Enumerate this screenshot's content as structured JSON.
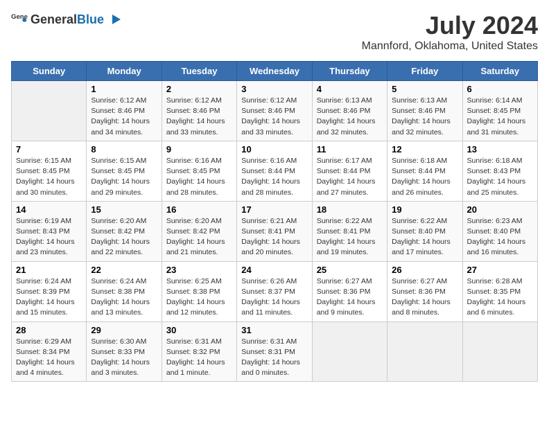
{
  "logo": {
    "general": "General",
    "blue": "Blue"
  },
  "title": "July 2024",
  "subtitle": "Mannford, Oklahoma, United States",
  "days_header": [
    "Sunday",
    "Monday",
    "Tuesday",
    "Wednesday",
    "Thursday",
    "Friday",
    "Saturday"
  ],
  "weeks": [
    [
      {
        "day": "",
        "sunrise": "",
        "sunset": "",
        "daylight": ""
      },
      {
        "day": "1",
        "sunrise": "Sunrise: 6:12 AM",
        "sunset": "Sunset: 8:46 PM",
        "daylight": "Daylight: 14 hours and 34 minutes."
      },
      {
        "day": "2",
        "sunrise": "Sunrise: 6:12 AM",
        "sunset": "Sunset: 8:46 PM",
        "daylight": "Daylight: 14 hours and 33 minutes."
      },
      {
        "day": "3",
        "sunrise": "Sunrise: 6:12 AM",
        "sunset": "Sunset: 8:46 PM",
        "daylight": "Daylight: 14 hours and 33 minutes."
      },
      {
        "day": "4",
        "sunrise": "Sunrise: 6:13 AM",
        "sunset": "Sunset: 8:46 PM",
        "daylight": "Daylight: 14 hours and 32 minutes."
      },
      {
        "day": "5",
        "sunrise": "Sunrise: 6:13 AM",
        "sunset": "Sunset: 8:46 PM",
        "daylight": "Daylight: 14 hours and 32 minutes."
      },
      {
        "day": "6",
        "sunrise": "Sunrise: 6:14 AM",
        "sunset": "Sunset: 8:45 PM",
        "daylight": "Daylight: 14 hours and 31 minutes."
      }
    ],
    [
      {
        "day": "7",
        "sunrise": "Sunrise: 6:15 AM",
        "sunset": "Sunset: 8:45 PM",
        "daylight": "Daylight: 14 hours and 30 minutes."
      },
      {
        "day": "8",
        "sunrise": "Sunrise: 6:15 AM",
        "sunset": "Sunset: 8:45 PM",
        "daylight": "Daylight: 14 hours and 29 minutes."
      },
      {
        "day": "9",
        "sunrise": "Sunrise: 6:16 AM",
        "sunset": "Sunset: 8:45 PM",
        "daylight": "Daylight: 14 hours and 28 minutes."
      },
      {
        "day": "10",
        "sunrise": "Sunrise: 6:16 AM",
        "sunset": "Sunset: 8:44 PM",
        "daylight": "Daylight: 14 hours and 28 minutes."
      },
      {
        "day": "11",
        "sunrise": "Sunrise: 6:17 AM",
        "sunset": "Sunset: 8:44 PM",
        "daylight": "Daylight: 14 hours and 27 minutes."
      },
      {
        "day": "12",
        "sunrise": "Sunrise: 6:18 AM",
        "sunset": "Sunset: 8:44 PM",
        "daylight": "Daylight: 14 hours and 26 minutes."
      },
      {
        "day": "13",
        "sunrise": "Sunrise: 6:18 AM",
        "sunset": "Sunset: 8:43 PM",
        "daylight": "Daylight: 14 hours and 25 minutes."
      }
    ],
    [
      {
        "day": "14",
        "sunrise": "Sunrise: 6:19 AM",
        "sunset": "Sunset: 8:43 PM",
        "daylight": "Daylight: 14 hours and 23 minutes."
      },
      {
        "day": "15",
        "sunrise": "Sunrise: 6:20 AM",
        "sunset": "Sunset: 8:42 PM",
        "daylight": "Daylight: 14 hours and 22 minutes."
      },
      {
        "day": "16",
        "sunrise": "Sunrise: 6:20 AM",
        "sunset": "Sunset: 8:42 PM",
        "daylight": "Daylight: 14 hours and 21 minutes."
      },
      {
        "day": "17",
        "sunrise": "Sunrise: 6:21 AM",
        "sunset": "Sunset: 8:41 PM",
        "daylight": "Daylight: 14 hours and 20 minutes."
      },
      {
        "day": "18",
        "sunrise": "Sunrise: 6:22 AM",
        "sunset": "Sunset: 8:41 PM",
        "daylight": "Daylight: 14 hours and 19 minutes."
      },
      {
        "day": "19",
        "sunrise": "Sunrise: 6:22 AM",
        "sunset": "Sunset: 8:40 PM",
        "daylight": "Daylight: 14 hours and 17 minutes."
      },
      {
        "day": "20",
        "sunrise": "Sunrise: 6:23 AM",
        "sunset": "Sunset: 8:40 PM",
        "daylight": "Daylight: 14 hours and 16 minutes."
      }
    ],
    [
      {
        "day": "21",
        "sunrise": "Sunrise: 6:24 AM",
        "sunset": "Sunset: 8:39 PM",
        "daylight": "Daylight: 14 hours and 15 minutes."
      },
      {
        "day": "22",
        "sunrise": "Sunrise: 6:24 AM",
        "sunset": "Sunset: 8:38 PM",
        "daylight": "Daylight: 14 hours and 13 minutes."
      },
      {
        "day": "23",
        "sunrise": "Sunrise: 6:25 AM",
        "sunset": "Sunset: 8:38 PM",
        "daylight": "Daylight: 14 hours and 12 minutes."
      },
      {
        "day": "24",
        "sunrise": "Sunrise: 6:26 AM",
        "sunset": "Sunset: 8:37 PM",
        "daylight": "Daylight: 14 hours and 11 minutes."
      },
      {
        "day": "25",
        "sunrise": "Sunrise: 6:27 AM",
        "sunset": "Sunset: 8:36 PM",
        "daylight": "Daylight: 14 hours and 9 minutes."
      },
      {
        "day": "26",
        "sunrise": "Sunrise: 6:27 AM",
        "sunset": "Sunset: 8:36 PM",
        "daylight": "Daylight: 14 hours and 8 minutes."
      },
      {
        "day": "27",
        "sunrise": "Sunrise: 6:28 AM",
        "sunset": "Sunset: 8:35 PM",
        "daylight": "Daylight: 14 hours and 6 minutes."
      }
    ],
    [
      {
        "day": "28",
        "sunrise": "Sunrise: 6:29 AM",
        "sunset": "Sunset: 8:34 PM",
        "daylight": "Daylight: 14 hours and 4 minutes."
      },
      {
        "day": "29",
        "sunrise": "Sunrise: 6:30 AM",
        "sunset": "Sunset: 8:33 PM",
        "daylight": "Daylight: 14 hours and 3 minutes."
      },
      {
        "day": "30",
        "sunrise": "Sunrise: 6:31 AM",
        "sunset": "Sunset: 8:32 PM",
        "daylight": "Daylight: 14 hours and 1 minute."
      },
      {
        "day": "31",
        "sunrise": "Sunrise: 6:31 AM",
        "sunset": "Sunset: 8:31 PM",
        "daylight": "Daylight: 14 hours and 0 minutes."
      },
      {
        "day": "",
        "sunrise": "",
        "sunset": "",
        "daylight": ""
      },
      {
        "day": "",
        "sunrise": "",
        "sunset": "",
        "daylight": ""
      },
      {
        "day": "",
        "sunrise": "",
        "sunset": "",
        "daylight": ""
      }
    ]
  ]
}
